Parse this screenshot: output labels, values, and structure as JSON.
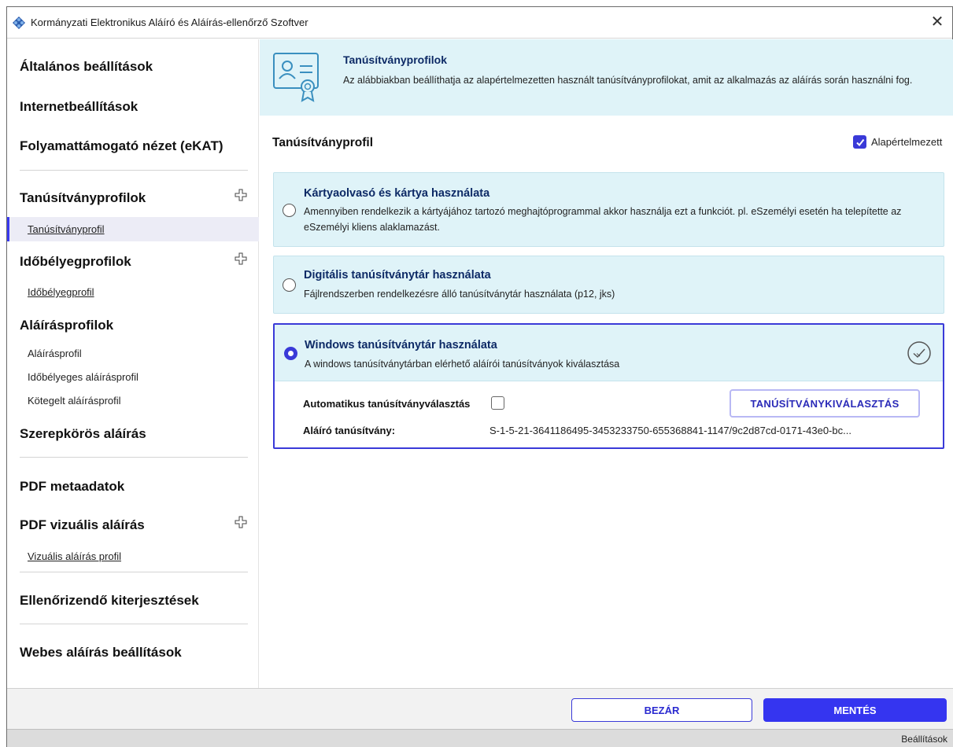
{
  "window": {
    "title": "Kormányzati Elektronikus Aláíró és Aláírás-ellenőrző Szoftver",
    "close_symbol": "✕"
  },
  "sidebar": {
    "general": "Általános beállítások",
    "internet": "Internetbeállítások",
    "workflow": "Folyamattámogató nézet (eKAT)",
    "cert_profiles": "Tanúsítványprofilok",
    "cert_profile": "Tanúsítványprofil",
    "timestamp_profiles": "Időbélyegprofilok",
    "timestamp_profile": "Időbélyegprofil",
    "signature_profiles": "Aláírásprofilok",
    "signature_profile": "Aláírásprofil",
    "timestamped_signature_profile": "Időbélyeges aláírásprofil",
    "batch_signature_profile": "Kötegelt aláírásprofil",
    "role_signature": "Szerepkörös aláírás",
    "pdf_metadata": "PDF metaadatok",
    "pdf_visual": "PDF vizuális aláírás",
    "visual_profile": "Vizuális aláírás profil",
    "extensions": "Ellenőrizendő kiterjesztések",
    "web_signature": "Webes aláírás beállítások",
    "add_icon": "plus-outline-icon"
  },
  "banner": {
    "title": "Tanúsítványprofilok",
    "description": "Az alábbiakban beállíthatja az alapértelmezetten használt tanúsítványprofilokat, amit az alkalmazás az aláírás során használni fog.",
    "icon": "certificate-card-icon"
  },
  "section": {
    "title": "Tanúsítványprofil",
    "default_label": "Alapértelmezett",
    "default_checked": true
  },
  "options": {
    "card_reader": {
      "title": "Kártyaolvasó és kártya használata",
      "description": "Amennyiben rendelkezik a kártyájához tartozó meghajtóprogrammal akkor használja ezt a funkciót. pl. eSzemélyi esetén ha telepítette az eSzemélyi kliens alaklamazást."
    },
    "digital_store": {
      "title": "Digitális tanúsítványtár használata",
      "description": "Fájlrendszerben rendelkezésre álló tanúsítványtár használata (p12, jks)"
    },
    "windows_store": {
      "title": "Windows tanúsítványtár használata",
      "description": "A windows tanúsítványtárban elérhető aláírói tanúsítványok kiválasztása",
      "auto_label": "Automatikus tanúsítványválasztás",
      "auto_checked": false,
      "select_button": "TANÚSÍTVÁNYKIVÁLASZTÁS",
      "cert_label": "Aláíró tanúsítvány:",
      "cert_value": "S-1-5-21-3641186495-3453233750-655368841-1147/9c2d87cd-0171-43e0-bc..."
    },
    "selected": "windows_store"
  },
  "footer": {
    "close_label": "BEZÁR",
    "save_label": "MENTÉS"
  },
  "status": {
    "text": "Beállítások"
  },
  "colors": {
    "accent": "#3535f0",
    "banner_bg": "#dff3f8",
    "heading_blue": "#0d2a66"
  }
}
